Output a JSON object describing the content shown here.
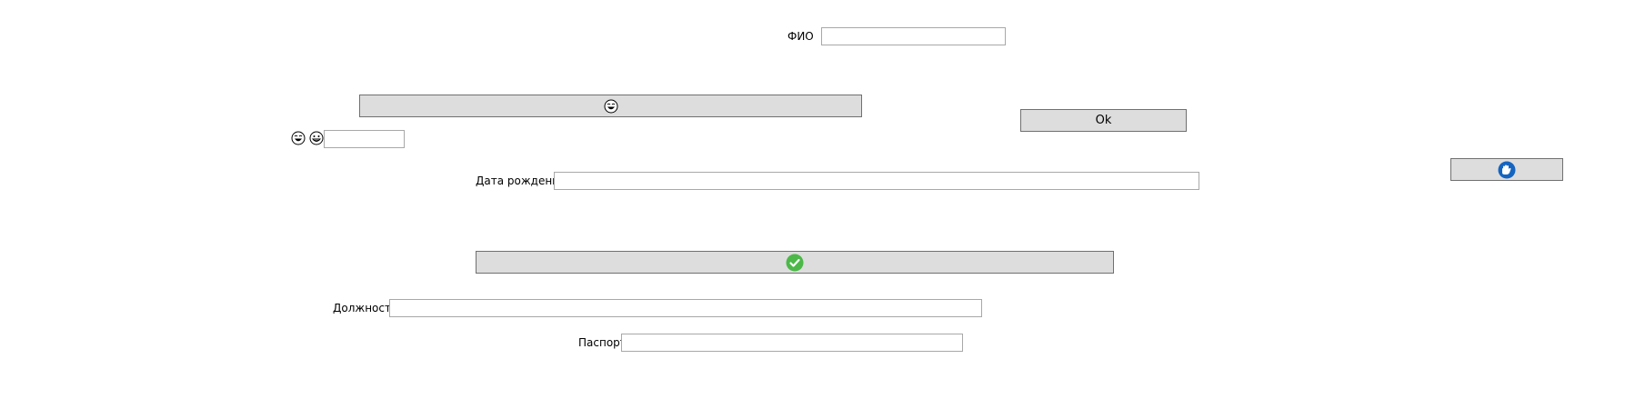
{
  "form": {
    "fio_label": "ФИО",
    "fio_value": "",
    "emoji_field_value": "",
    "birthdate_label": "Дата рождения",
    "birthdate_value": "",
    "position_label": "Должность",
    "position_value": "",
    "passport_label": "Паспорт",
    "passport_value": ""
  },
  "buttons": {
    "ok_label": "Ok"
  },
  "icons": {
    "laughing_face": "laughing-face-icon",
    "grinning_face": "grinning-face-icon",
    "check": "check-circle-icon",
    "hand": "hand-icon"
  },
  "colors": {
    "check_green": "#4cb848",
    "hand_blue": "#1565c0",
    "button_bg": "#dddddd"
  }
}
